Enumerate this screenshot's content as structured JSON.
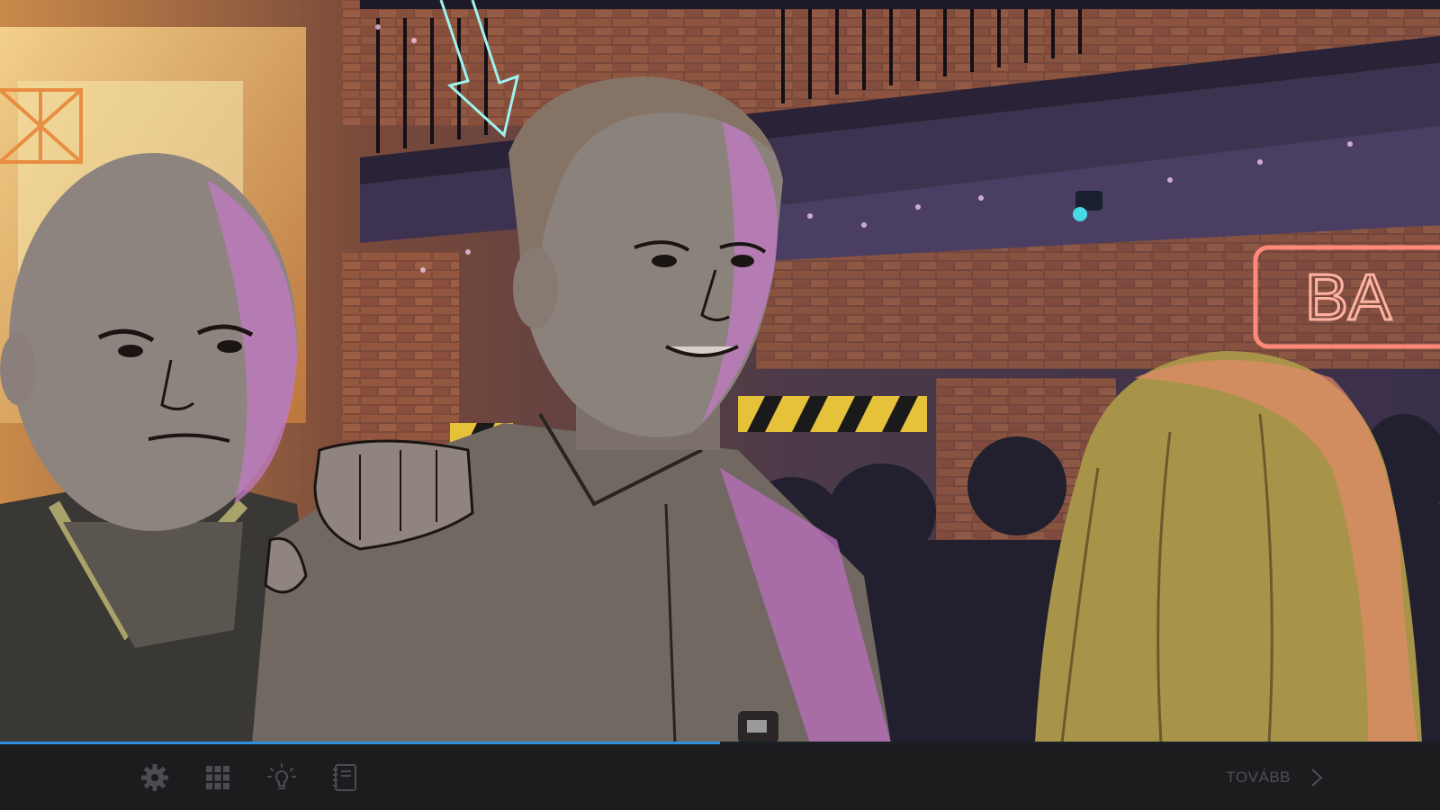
{
  "scene": {
    "neon_sign_text": "BA",
    "characters": [
      "bald-man",
      "smiling-man",
      "red-haired-woman"
    ]
  },
  "progress": {
    "value": 0.5
  },
  "toolbar": {
    "settings_icon": "gear-icon",
    "menu_icon": "grid-icon",
    "hint_icon": "lightbulb-icon",
    "notebook_icon": "notebook-icon",
    "next_label": "TOVÁBB",
    "next_icon": "chevron-right-icon"
  },
  "colors": {
    "toolbar_bg": "#1b1c1e",
    "icon_color": "#4a4c50",
    "progress_accent": "#2f8fe0"
  }
}
